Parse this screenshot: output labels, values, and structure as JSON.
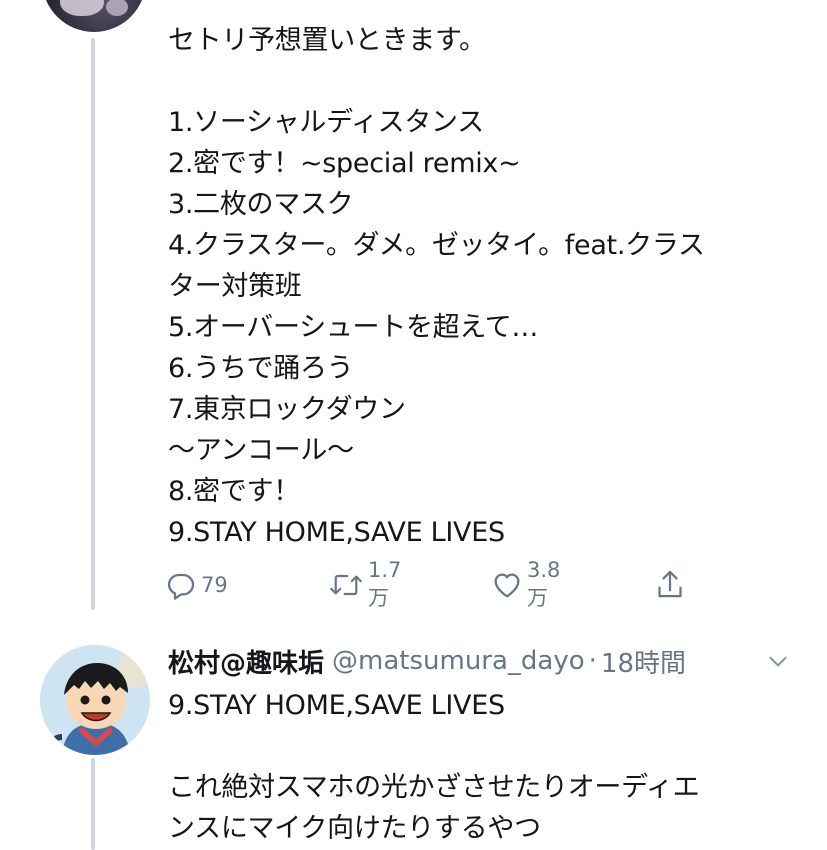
{
  "tweet1": {
    "lines": [
      "セトリ予想置いときます。",
      "",
      "1.ソーシャルディスタンス",
      "2.密です！~special remix~",
      "3.二枚のマスク",
      "4.クラスター。ダメ。ゼッタイ。feat.クラス",
      "ター対策班",
      "5.オーバーシュートを超えて…",
      "6.うちで踊ろう",
      "7.東京ロックダウン",
      "〜アンコール〜",
      "8.密です！",
      "9.STAY HOME,SAVE LIVES"
    ],
    "actions": {
      "reply_count": "79",
      "retweet_count": "1.7万",
      "like_count": "3.8万"
    }
  },
  "tweet2": {
    "display_name": "松村@趣味垢",
    "handle": "@matsumura_dayo",
    "separator": "·",
    "time": "18時間",
    "lines": [
      "9.STAY HOME,SAVE LIVES",
      "",
      "これ絶対スマホの光かざさせたりオーディエ",
      "ンスにマイク向けたりするやつ"
    ]
  },
  "colors": {
    "text": "#14171a",
    "secondary": "#657786",
    "thread_line": "#ccd6dd"
  },
  "icons": {
    "reply": "reply-icon",
    "retweet": "retweet-icon",
    "like": "heart-icon",
    "share": "share-icon",
    "more": "chevron-down-icon"
  }
}
